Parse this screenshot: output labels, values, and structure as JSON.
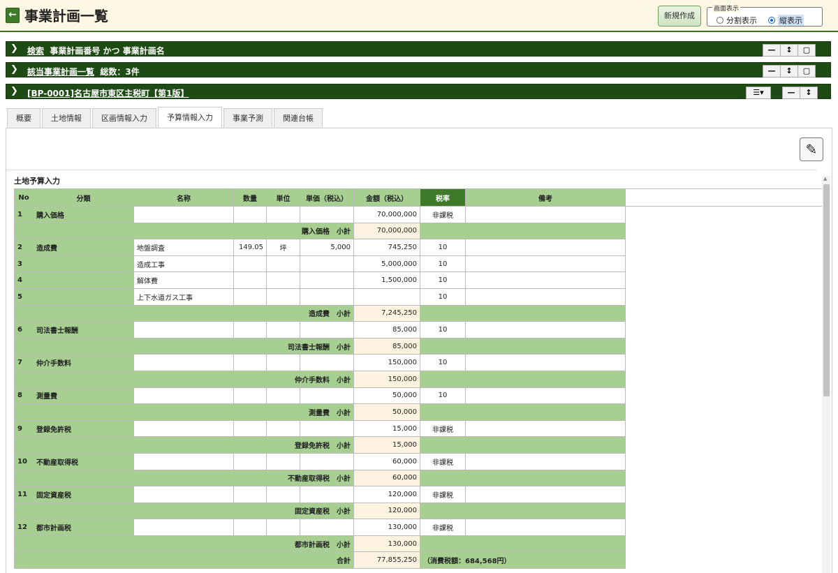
{
  "header": {
    "title": "事業計画一覧",
    "new_button": "新規作成",
    "view_label": "画面表示",
    "view_options": [
      "分割表示",
      "縦表示"
    ],
    "view_selected": "縦表示"
  },
  "sections": [
    {
      "link": "検索",
      "text": "事業計画番号 かつ 事業計画名"
    },
    {
      "link": "該当事業計画一覧",
      "text": "総数：3件"
    },
    {
      "link": "[BP-0001]名古屋市東区主税町【第1版】",
      "text": ""
    }
  ],
  "tabs": [
    "概要",
    "土地情報",
    "区画情報入力",
    "予算情報入力",
    "事業予測",
    "関連台帳"
  ],
  "active_tab": "予算情報入力",
  "table": {
    "title": "土地予算入力",
    "headers": [
      "No",
      "分類",
      "名称",
      "数量",
      "単位",
      "単価（税込）",
      "金額（税込）",
      "税率",
      "備考"
    ],
    "groups": [
      {
        "category": "購入価格",
        "rows": [
          {
            "no": "1",
            "name": "",
            "qty": "",
            "unit": "",
            "price": "",
            "amount": "70,000,000",
            "tax": "非課税"
          }
        ],
        "subtotal_label": "購入価格　小計",
        "subtotal": "70,000,000"
      },
      {
        "category": "造成費",
        "rows": [
          {
            "no": "2",
            "name": "地盤調査",
            "qty": "149.05",
            "unit": "坪",
            "price": "5,000",
            "amount": "745,250",
            "tax": "10"
          },
          {
            "no": "3",
            "name": "造成工事",
            "qty": "",
            "unit": "",
            "price": "",
            "amount": "5,000,000",
            "tax": "10"
          },
          {
            "no": "4",
            "name": "解体費",
            "qty": "",
            "unit": "",
            "price": "",
            "amount": "1,500,000",
            "tax": "10"
          },
          {
            "no": "5",
            "name": "上下水道ガス工事",
            "qty": "",
            "unit": "",
            "price": "",
            "amount": "",
            "tax": "10"
          }
        ],
        "subtotal_label": "造成費　小計",
        "subtotal": "7,245,250"
      },
      {
        "category": "司法書士報酬",
        "rows": [
          {
            "no": "6",
            "name": "",
            "qty": "",
            "unit": "",
            "price": "",
            "amount": "85,000",
            "tax": "10"
          }
        ],
        "subtotal_label": "司法書士報酬　小計",
        "subtotal": "85,000"
      },
      {
        "category": "仲介手数料",
        "rows": [
          {
            "no": "7",
            "name": "",
            "qty": "",
            "unit": "",
            "price": "",
            "amount": "150,000",
            "tax": "10"
          }
        ],
        "subtotal_label": "仲介手数料　小計",
        "subtotal": "150,000"
      },
      {
        "category": "測量費",
        "rows": [
          {
            "no": "8",
            "name": "",
            "qty": "",
            "unit": "",
            "price": "",
            "amount": "50,000",
            "tax": "10"
          }
        ],
        "subtotal_label": "測量費　小計",
        "subtotal": "50,000"
      },
      {
        "category": "登録免許税",
        "rows": [
          {
            "no": "9",
            "name": "",
            "qty": "",
            "unit": "",
            "price": "",
            "amount": "15,000",
            "tax": "非課税"
          }
        ],
        "subtotal_label": "登録免許税　小計",
        "subtotal": "15,000"
      },
      {
        "category": "不動産取得税",
        "rows": [
          {
            "no": "10",
            "name": "",
            "qty": "",
            "unit": "",
            "price": "",
            "amount": "60,000",
            "tax": "非課税"
          }
        ],
        "subtotal_label": "不動産取得税　小計",
        "subtotal": "60,000"
      },
      {
        "category": "固定資産税",
        "rows": [
          {
            "no": "11",
            "name": "",
            "qty": "",
            "unit": "",
            "price": "",
            "amount": "120,000",
            "tax": "非課税"
          }
        ],
        "subtotal_label": "固定資産税　小計",
        "subtotal": "120,000"
      },
      {
        "category": "都市計画税",
        "rows": [
          {
            "no": "12",
            "name": "",
            "qty": "",
            "unit": "",
            "price": "",
            "amount": "130,000",
            "tax": "非課税"
          }
        ],
        "subtotal_label": "都市計画税　小計",
        "subtotal": "130,000"
      }
    ],
    "total_label": "合計",
    "total": "77,855,250",
    "total_note": "（消費税額：684,568円）"
  },
  "colors": {
    "bar": "#1e4a14",
    "header_green": "#a7cf92",
    "tax_header": "#3e7a2a",
    "subtotal_bg": "#fdf3e0"
  }
}
